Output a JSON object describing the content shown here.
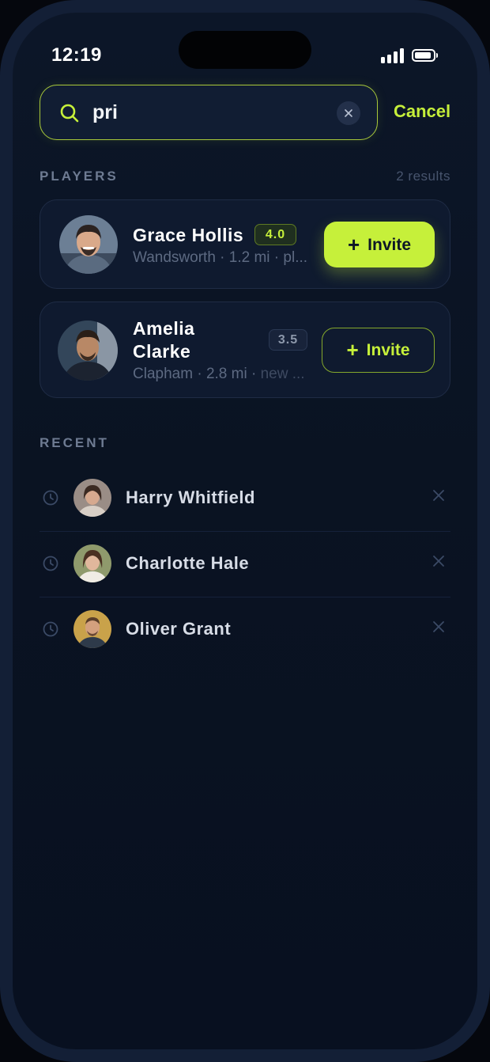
{
  "status_bar": {
    "time": "12:19"
  },
  "search": {
    "query": "pri",
    "cancel_label": "Cancel"
  },
  "players_section": {
    "label": "PLAYERS",
    "results_count": "2 results",
    "players": [
      {
        "name": "Grace Hollis",
        "rating": "4.0",
        "location": "Wandsworth",
        "distance": "1.2 mi",
        "extra": "pl...",
        "invite_label": "Invite",
        "invite_style": "primary"
      },
      {
        "name_line1": "Amelia",
        "name_line2": "Clarke",
        "rating": "3.5",
        "location": "Clapham",
        "distance": "2.8 mi",
        "extra": "new ...",
        "invite_label": "Invite",
        "invite_style": "outline"
      }
    ]
  },
  "recent_section": {
    "label": "RECENT",
    "items": [
      {
        "name": "Harry Whitfield"
      },
      {
        "name": "Charlotte Hale"
      },
      {
        "name": "Oliver Grant"
      }
    ]
  },
  "colors": {
    "accent": "#c6f03a",
    "background": "#0a1322",
    "card": "#0f1a2f",
    "muted_text": "#5d6a82"
  },
  "icons": [
    "search-icon",
    "clear-icon",
    "plus-icon",
    "clock-icon",
    "close-icon",
    "signal-icon",
    "battery-icon"
  ]
}
